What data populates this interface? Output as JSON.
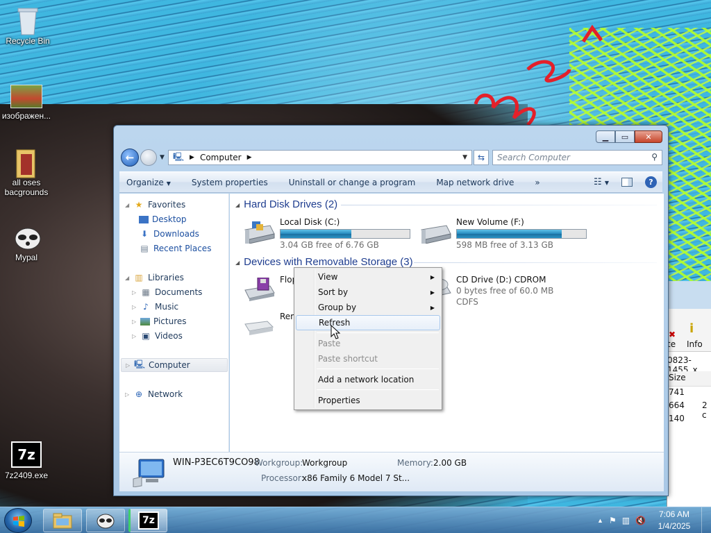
{
  "desktop": {
    "icons": [
      {
        "label": "Recycle Bin"
      },
      {
        "label": "изображен..."
      },
      {
        "label": "all oses bacgrounds"
      },
      {
        "label": "Mypal"
      },
      {
        "label": "7z2409.exe"
      }
    ]
  },
  "window": {
    "address": {
      "root": "Computer"
    },
    "search_placeholder": "Search Computer",
    "toolbar": {
      "organize": "Organize",
      "system_properties": "System properties",
      "uninstall": "Uninstall or change a program",
      "map_drive": "Map network drive",
      "more": "»"
    },
    "nav": {
      "favorites": "Favorites",
      "desktop": "Desktop",
      "downloads": "Downloads",
      "recent": "Recent Places",
      "libraries": "Libraries",
      "documents": "Documents",
      "music": "Music",
      "pictures": "Pictures",
      "videos": "Videos",
      "computer": "Computer",
      "network": "Network"
    },
    "groups": {
      "hdd": "Hard Disk Drives (2)",
      "removable": "Devices with Removable Storage (3)"
    },
    "drives": {
      "c": {
        "name": "Local Disk (C:)",
        "free": "3.04 GB free of 6.76 GB",
        "used_fraction": 0.55
      },
      "f": {
        "name": "New Volume (F:)",
        "free": "598 MB free of 3.13 GB",
        "used_fraction": 0.81
      },
      "floppy": {
        "name": "Flop"
      },
      "removable": {
        "name": "Rem"
      },
      "cd": {
        "name": "CD Drive (D:) CDROM",
        "free": "0 bytes free of 60.0 MB",
        "fs": "CDFS"
      }
    },
    "details": {
      "computer_name": "WIN-P3EC6T9CO98",
      "workgroup_label": "Workgroup:",
      "workgroup": "Workgroup",
      "memory_label": "Memory:",
      "memory": "2.00 GB",
      "processor_label": "Processor:",
      "processor": "x86 Family 6 Model 7 St..."
    }
  },
  "context_menu": {
    "view": "View",
    "sort_by": "Sort by",
    "group_by": "Group by",
    "refresh": "Refresh",
    "paste": "Paste",
    "paste_shortcut": "Paste shortcut",
    "add_network": "Add a network location",
    "properties": "Properties"
  },
  "background_window": {
    "te": "te",
    "info": "Info",
    "path": "0823-1455_x",
    "size_header": "Size",
    "sizes": [
      "741",
      "664",
      "140"
    ],
    "extra": "2 c"
  },
  "taskbar": {
    "time": "7:06 AM",
    "date": "1/4/2025"
  },
  "colors": {
    "accent": "#1e3d8f",
    "drive_bar": "#2389bd"
  }
}
